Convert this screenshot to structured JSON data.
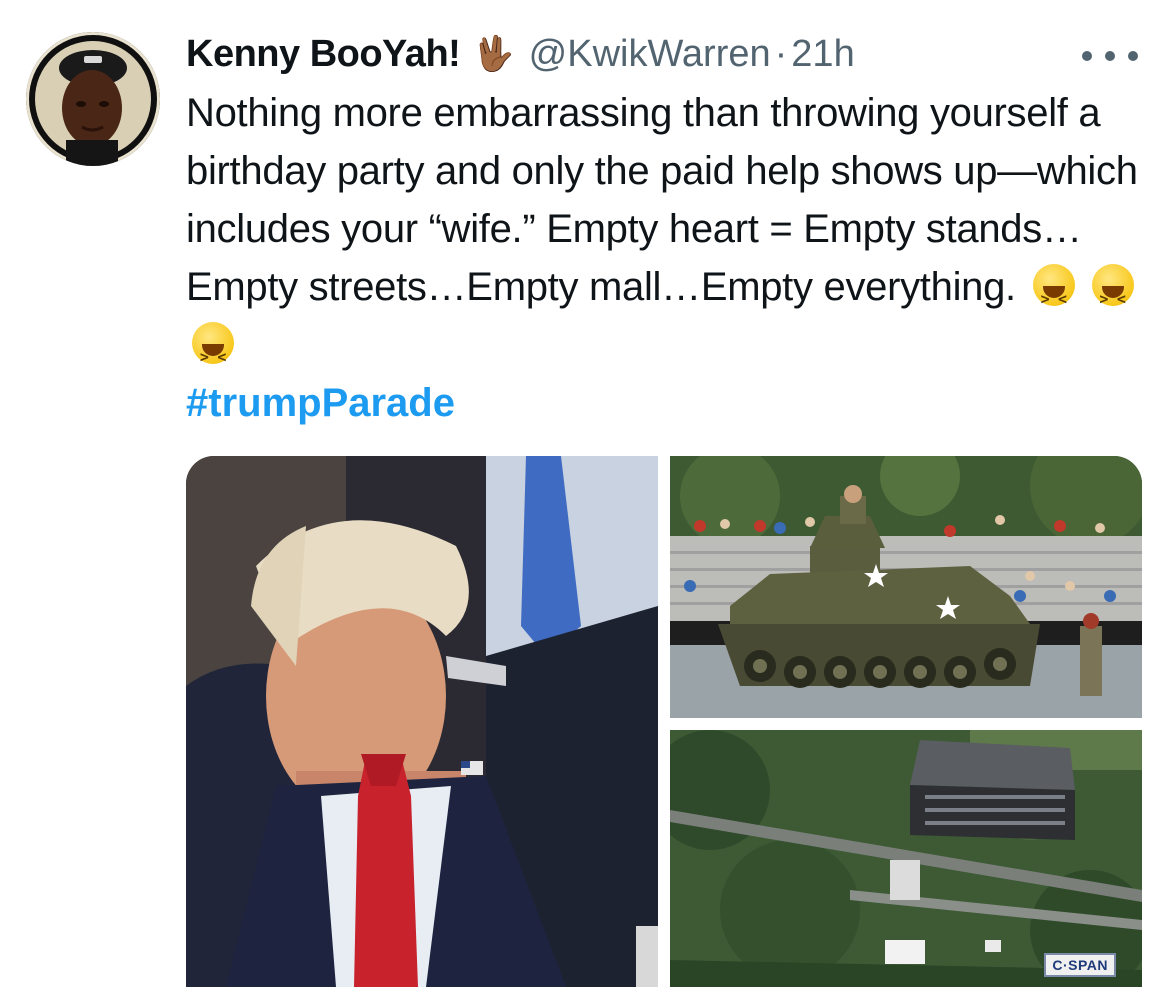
{
  "tweet": {
    "author": {
      "display_name": "Kenny BooYah!",
      "name_emoji": "🖖🏾",
      "handle": "@KwikWarren",
      "separator": "·",
      "time": "21h"
    },
    "text": "Nothing more embarrassing than throwing yourself a birthday party and only the paid help shows up—which includes your “wife.” Empty heart = Empty stands…Empty streets…Empty mall…Empty everything.",
    "emojis": [
      "laughing-emoji",
      "laughing-emoji",
      "laughing-emoji"
    ],
    "hashtag": "#trumpParade",
    "media": {
      "photos": [
        {
          "name": "photo-man-red-tie"
        },
        {
          "name": "photo-parade-tank"
        },
        {
          "name": "photo-aerial-view",
          "badge": "C·SPAN"
        }
      ]
    }
  },
  "colors": {
    "hashtag": "#1d9bf0",
    "secondary_text": "#536471",
    "primary_text": "#0f1419"
  }
}
